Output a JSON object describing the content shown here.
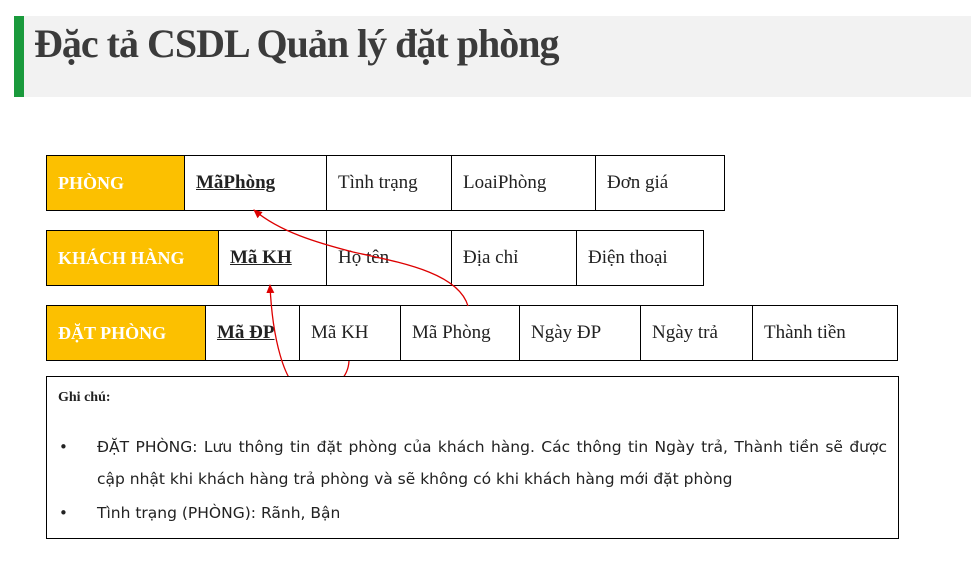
{
  "title": "Đặc tả CSDL Quản lý đặt phòng",
  "tables": {
    "phong": {
      "name": "PHÒNG",
      "fields": [
        "MãPhòng",
        "Tình trạng",
        "LoaiPhòng",
        "Đơn giá"
      ]
    },
    "khach_hang": {
      "name": "KHÁCH HÀNG",
      "fields": [
        "Mã KH",
        "Họ tên",
        "Địa chỉ",
        "Điện thoại"
      ]
    },
    "dat_phong": {
      "name": "ĐẶT PHÒNG",
      "fields": [
        "Mã ĐP",
        "Mã KH",
        "Mã Phòng",
        "Ngày ĐP",
        "Ngày trả",
        "Thành tiền"
      ]
    }
  },
  "note": {
    "title": "Ghi chú:",
    "bullet": "•",
    "items": [
      "ĐẶT PHÒNG: Lưu thông tin đặt phòng của khách hàng. Các thông tin Ngày trả, Thành tiền sẽ được cập nhật khi khách hàng trả phòng và sẽ không có khi khách hàng mới đặt phòng",
      "Tình trạng (PHÒNG): Rãnh, Bận"
    ]
  },
  "colors": {
    "accent_green": "#1a9a3c",
    "table_header": "#fcc000",
    "arrow": "#dd0000"
  }
}
